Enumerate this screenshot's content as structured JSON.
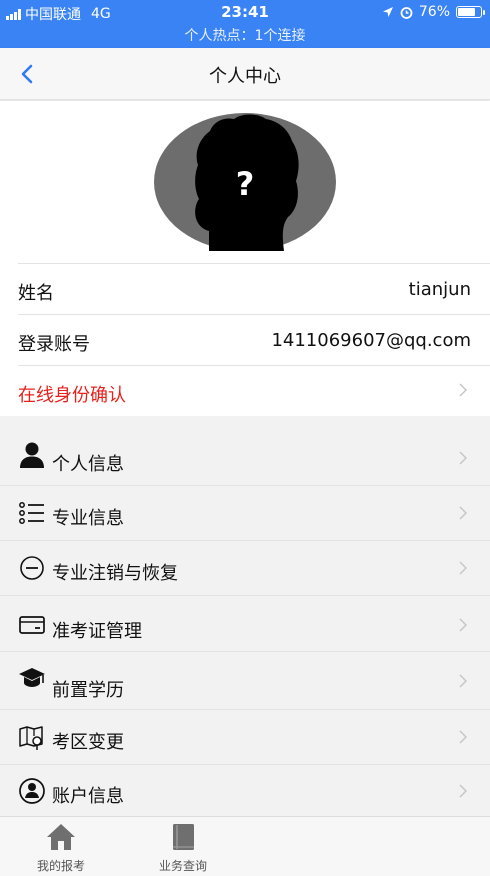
{
  "status_bar": {
    "carrier": "中国联通",
    "network": "4G",
    "time": "23:41",
    "battery": "76%",
    "battery_level": 0.76,
    "hotspot": "个人热点：1个连接"
  },
  "nav": {
    "title": "个人中心"
  },
  "profile": {
    "avatar_symbol": "?",
    "name_label": "姓名",
    "name_value": "tianjun",
    "account_label": "登录账号",
    "account_value": "1411069607@qq.com",
    "verify_label": "在线身份确认"
  },
  "menu": {
    "items": [
      {
        "label": "个人信息",
        "icon": "person-icon"
      },
      {
        "label": "专业信息",
        "icon": "list-icon"
      },
      {
        "label": "专业注销与恢复",
        "icon": "minus-circle-icon"
      },
      {
        "label": "准考证管理",
        "icon": "card-icon"
      },
      {
        "label": "前置学历",
        "icon": "graduation-cap-icon"
      },
      {
        "label": "考区变更",
        "icon": "map-icon"
      },
      {
        "label": "账户信息",
        "icon": "account-circle-icon"
      }
    ]
  },
  "tabbar": {
    "tabs": [
      {
        "label": "我的报考",
        "icon": "home-icon"
      },
      {
        "label": "业务查询",
        "icon": "book-icon"
      }
    ]
  },
  "colors": {
    "status_blue": "#3a83f5",
    "accent_blue": "#2f7cf6",
    "alert_red": "#e8201c"
  }
}
